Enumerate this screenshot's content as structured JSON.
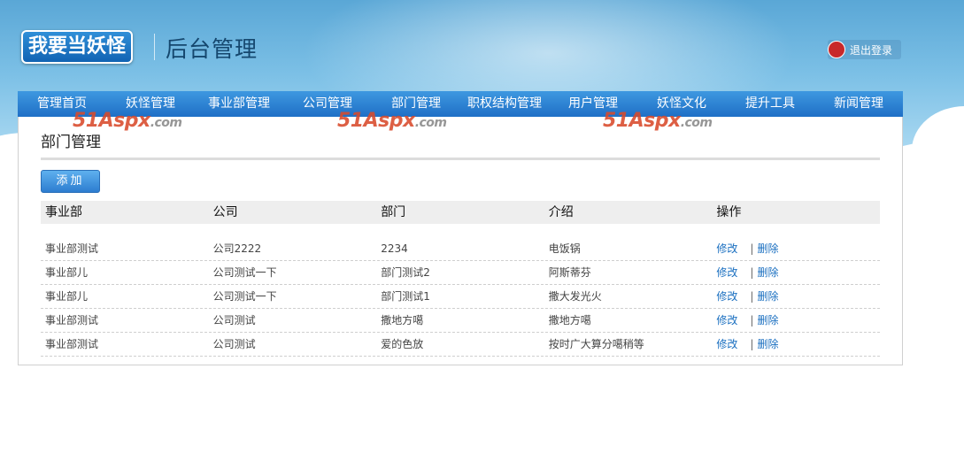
{
  "header": {
    "logo": "我要当妖怪",
    "subtitle": "后台管理",
    "logout_label": "退出登录"
  },
  "nav": {
    "items": [
      "管理首页",
      "妖怪管理",
      "事业部管理",
      "公司管理",
      "部门管理",
      "职权结构管理",
      "用户管理",
      "妖怪文化",
      "提升工具",
      "新闻管理"
    ]
  },
  "watermark": {
    "text": "51Aspx",
    "domain": ".com"
  },
  "panel": {
    "title": "部门管理",
    "add_label": "添加"
  },
  "table": {
    "headers": [
      "事业部",
      "公司",
      "部门",
      "介绍",
      "操作"
    ],
    "rows": [
      [
        "事业部测试",
        "公司2222",
        "2234",
        "电饭锅"
      ],
      [
        "事业部儿",
        "公司测试一下",
        "部门测试2",
        "阿斯蒂芬"
      ],
      [
        "事业部儿",
        "公司测试一下",
        "部门测试1",
        "撒大发光火"
      ],
      [
        "事业部测试",
        "公司测试",
        "撒地方噶",
        "撒地方噶"
      ],
      [
        "事业部测试",
        "公司测试",
        "爱的色放",
        "按时广大算分噶稍等"
      ]
    ],
    "edit_label": "修改",
    "delete_label": "删除",
    "separator": "|"
  },
  "colors": {
    "nav_bg": "#2a80d2",
    "link": "#1a6fc0",
    "header_sky": "#7cc0e6",
    "watermark": "#d94a2b"
  }
}
